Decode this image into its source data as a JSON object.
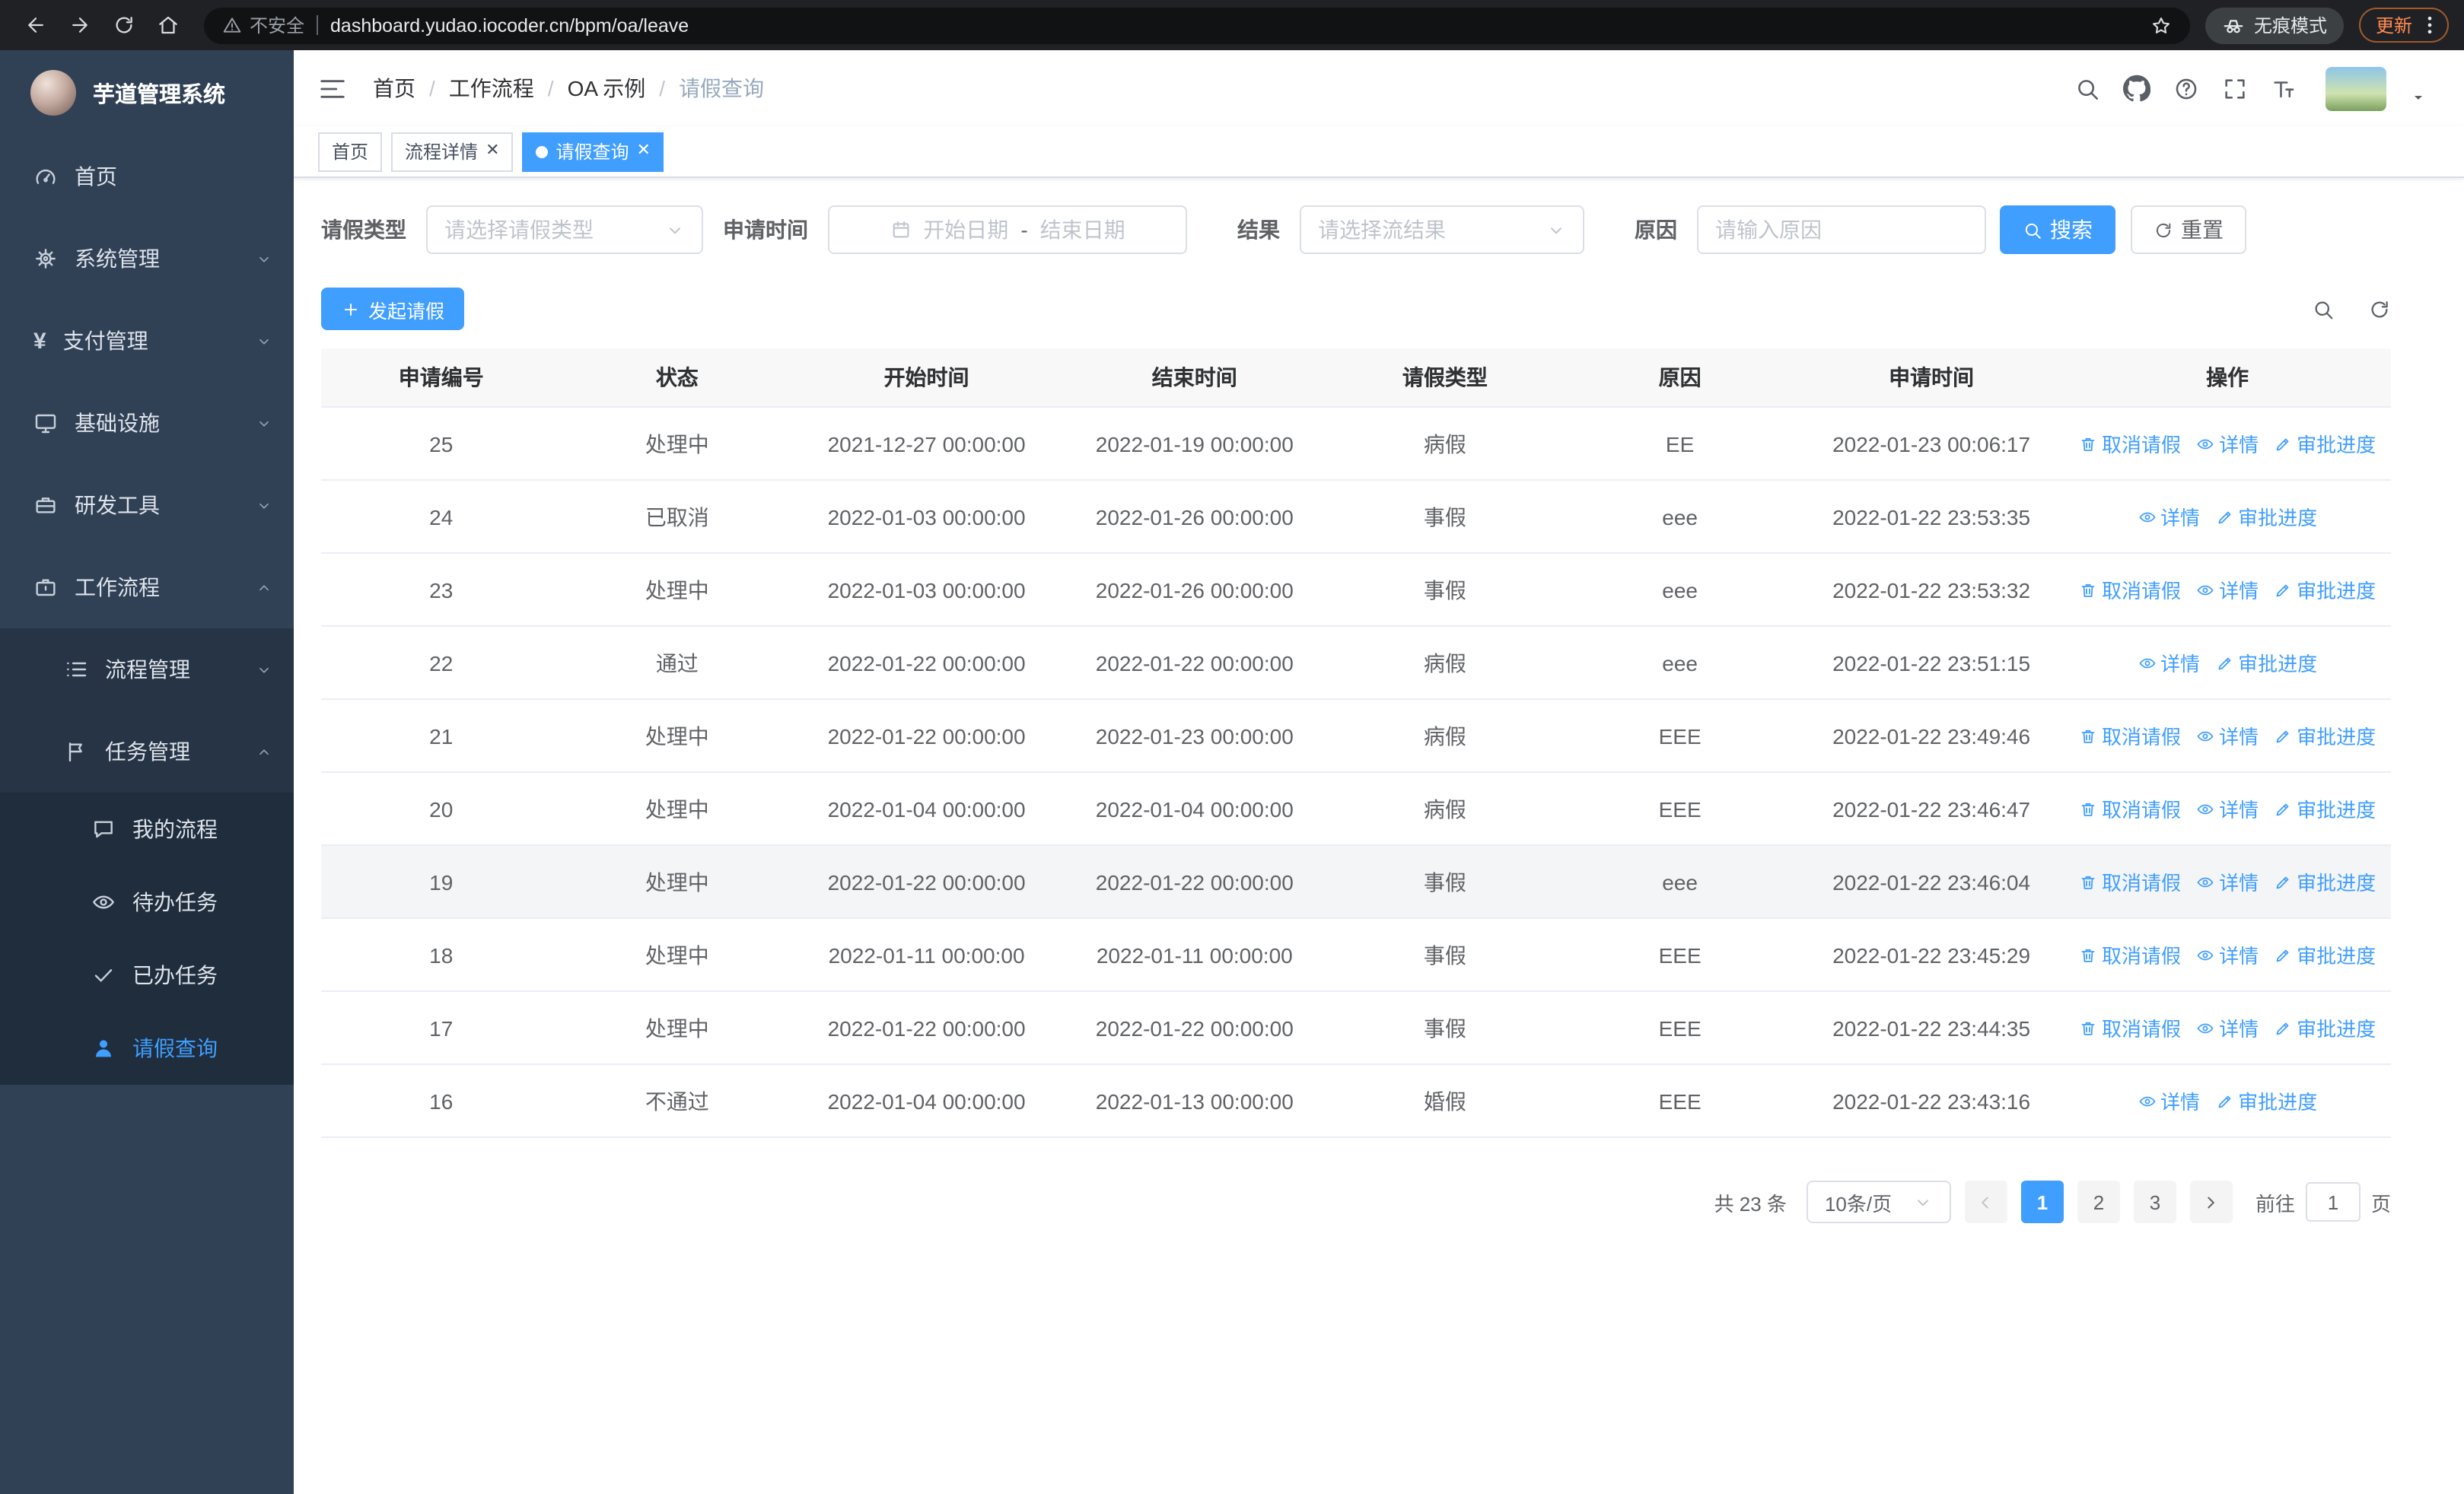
{
  "theme": {
    "accent": "#409eff",
    "chrome-bg": "#202124",
    "sidebar-bg": "#304156",
    "sidebar-sub-bg": "#263445",
    "sidebar-subsub-bg": "#1f2d3c"
  },
  "browser": {
    "security_warning": "不安全",
    "url": "dashboard.yudao.iocoder.cn/bpm/oa/leave",
    "incognito_label": "无痕模式",
    "update_label": "更新"
  },
  "sidebar": {
    "logo_title": "芋道管理系统",
    "items": [
      {
        "label": "首页"
      },
      {
        "label": "系统管理"
      },
      {
        "label": "支付管理"
      },
      {
        "label": "基础设施"
      },
      {
        "label": "研发工具"
      },
      {
        "label": "工作流程"
      }
    ],
    "workflow_children": [
      {
        "label": "流程管理"
      },
      {
        "label": "任务管理"
      }
    ],
    "task_children": [
      {
        "label": "我的流程"
      },
      {
        "label": "待办任务"
      },
      {
        "label": "已办任务"
      },
      {
        "label": "请假查询"
      }
    ]
  },
  "header": {
    "separator": "/",
    "breadcrumb": [
      "首页",
      "工作流程",
      "OA 示例",
      "请假查询"
    ]
  },
  "tabs": [
    {
      "label": "首页"
    },
    {
      "label": "流程详情"
    },
    {
      "label": "请假查询"
    }
  ],
  "filters": {
    "leave_type_label": "请假类型",
    "leave_type_placeholder": "请选择请假类型",
    "apply_time_label": "申请时间",
    "start_date_placeholder": "开始日期",
    "range_separator": "-",
    "end_date_placeholder": "结束日期",
    "result_label": "结果",
    "result_placeholder": "请选择流结果",
    "reason_label": "原因",
    "reason_placeholder": "请输入原因",
    "search_button": "搜索",
    "reset_button": "重置"
  },
  "toolbar": {
    "create_button": "发起请假"
  },
  "table": {
    "headers": [
      "申请编号",
      "状态",
      "开始时间",
      "结束时间",
      "请假类型",
      "原因",
      "申请时间",
      "操作"
    ],
    "actions": {
      "cancel": "取消请假",
      "detail": "详情",
      "progress": "审批进度"
    },
    "rows": [
      {
        "id": "25",
        "status": "处理中",
        "start": "2021-12-27 00:00:00",
        "end": "2022-01-19 00:00:00",
        "type": "病假",
        "reason": "EE",
        "applied": "2022-01-23 00:06:17",
        "cancelable": true,
        "highlighted": false
      },
      {
        "id": "24",
        "status": "已取消",
        "start": "2022-01-03 00:00:00",
        "end": "2022-01-26 00:00:00",
        "type": "事假",
        "reason": "eee",
        "applied": "2022-01-22 23:53:35",
        "cancelable": false,
        "highlighted": false
      },
      {
        "id": "23",
        "status": "处理中",
        "start": "2022-01-03 00:00:00",
        "end": "2022-01-26 00:00:00",
        "type": "事假",
        "reason": "eee",
        "applied": "2022-01-22 23:53:32",
        "cancelable": true,
        "highlighted": false
      },
      {
        "id": "22",
        "status": "通过",
        "start": "2022-01-22 00:00:00",
        "end": "2022-01-22 00:00:00",
        "type": "病假",
        "reason": "eee",
        "applied": "2022-01-22 23:51:15",
        "cancelable": false,
        "highlighted": false
      },
      {
        "id": "21",
        "status": "处理中",
        "start": "2022-01-22 00:00:00",
        "end": "2022-01-23 00:00:00",
        "type": "病假",
        "reason": "EEE",
        "applied": "2022-01-22 23:49:46",
        "cancelable": true,
        "highlighted": false
      },
      {
        "id": "20",
        "status": "处理中",
        "start": "2022-01-04 00:00:00",
        "end": "2022-01-04 00:00:00",
        "type": "病假",
        "reason": "EEE",
        "applied": "2022-01-22 23:46:47",
        "cancelable": true,
        "highlighted": false
      },
      {
        "id": "19",
        "status": "处理中",
        "start": "2022-01-22 00:00:00",
        "end": "2022-01-22 00:00:00",
        "type": "事假",
        "reason": "eee",
        "applied": "2022-01-22 23:46:04",
        "cancelable": true,
        "highlighted": true
      },
      {
        "id": "18",
        "status": "处理中",
        "start": "2022-01-11 00:00:00",
        "end": "2022-01-11 00:00:00",
        "type": "事假",
        "reason": "EEE",
        "applied": "2022-01-22 23:45:29",
        "cancelable": true,
        "highlighted": false
      },
      {
        "id": "17",
        "status": "处理中",
        "start": "2022-01-22 00:00:00",
        "end": "2022-01-22 00:00:00",
        "type": "事假",
        "reason": "EEE",
        "applied": "2022-01-22 23:44:35",
        "cancelable": true,
        "highlighted": false
      },
      {
        "id": "16",
        "status": "不通过",
        "start": "2022-01-04 00:00:00",
        "end": "2022-01-13 00:00:00",
        "type": "婚假",
        "reason": "EEE",
        "applied": "2022-01-22 23:43:16",
        "cancelable": false,
        "highlighted": false
      }
    ]
  },
  "pagination": {
    "total": "共 23 条",
    "page_size": "10条/页",
    "pages": [
      "1",
      "2",
      "3"
    ],
    "goto_label": "前往",
    "goto_value": "1",
    "page_suffix": "页"
  }
}
